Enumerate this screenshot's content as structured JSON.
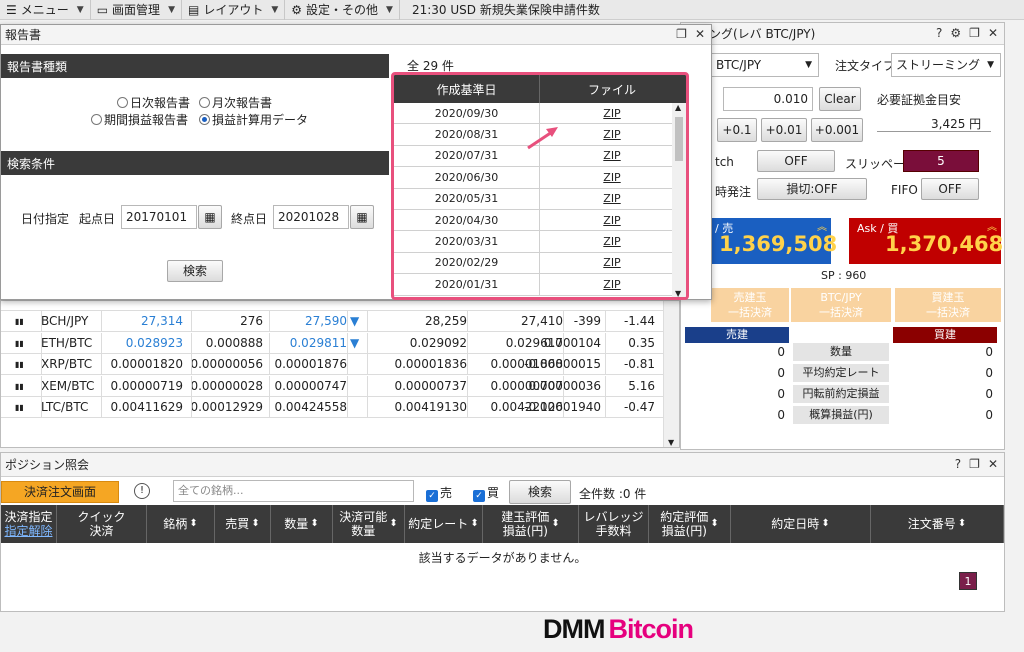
{
  "menubar": {
    "items": [
      {
        "icon": "menu-icon",
        "label": "メニュー"
      },
      {
        "icon": "screen-icon",
        "label": "画面管理"
      },
      {
        "icon": "layout-icon",
        "label": "レイアウト"
      },
      {
        "icon": "gear-icon",
        "label": "設定・その他"
      }
    ],
    "ticker": "21:30  USD  新規失業保険申請件数"
  },
  "trade": {
    "title_fragment": "ーミング(レバ BTC/JPY)",
    "symbol": "BTC/JPY",
    "order_type_label": "注文タイプ",
    "order_type_value": "ストリーミング",
    "qty_value": "0.010",
    "clear_label": "Clear",
    "margin_label": "必要証拠金目安",
    "margin_value": "3,425 円",
    "steps": [
      "+0.1",
      "+0.01",
      "+0.001"
    ],
    "match_label": "tch",
    "match_value": "OFF",
    "slippage_label": "スリッページ",
    "slippage_value": "5",
    "simul_label": "時発注",
    "simul_value": "損切:OFF",
    "fifo_label": "FIFO",
    "fifo_value": "OFF",
    "bid_label": "/ 売",
    "bid_price": "1,369,508",
    "ask_label": "Ask / 買",
    "ask_price": "1,370,468",
    "spread": "SP : 960",
    "bulk_sell": [
      "売建玉",
      "一括決済"
    ],
    "bulk_pair": [
      "BTC/JPY",
      "一括決済"
    ],
    "bulk_buy": [
      "買建玉",
      "一括決済"
    ],
    "sell_head": "売建",
    "buy_head": "買建",
    "summary": [
      {
        "sell": "0",
        "label": "数量",
        "buy": "0"
      },
      {
        "sell": "0",
        "label": "平均約定レート",
        "buy": "0"
      },
      {
        "sell": "0",
        "label": "円転前約定損益",
        "buy": "0"
      },
      {
        "sell": "0",
        "label": "概算損益(円)",
        "buy": "0"
      }
    ]
  },
  "market": {
    "rows": [
      {
        "pair": "BCH/JPY",
        "bid": "27,314",
        "spread": "276",
        "ask": "27,590",
        "low": "28,259",
        "high": "27,410",
        "change": "-399",
        "pct": "-1.44"
      },
      {
        "pair": "ETH/BTC",
        "bid": "0.028923",
        "spread": "0.000888",
        "ask": "0.029811",
        "low": "0.029092",
        "high": "0.029617",
        "change": "0.000104",
        "pct": "0.35"
      },
      {
        "pair": "XRP/BTC",
        "bid": "0.00001820",
        "spread": "0.00000056",
        "ask": "0.00001876",
        "low": "0.00001836",
        "high": "0.00001868",
        "change": "-0.00000015",
        "pct": "-0.81"
      },
      {
        "pair": "XEM/BTC",
        "bid": "0.00000719",
        "spread": "0.00000028",
        "ask": "0.00000747",
        "low": "0.00000737",
        "high": "0.00000707",
        "change": "0.00000036",
        "pct": "5.16"
      },
      {
        "pair": "LTC/BTC",
        "bid": "0.00411629",
        "spread": "0.00012929",
        "ask": "0.00424558",
        "low": "0.00419130",
        "high": "0.00422126",
        "change": "-0.00001940",
        "pct": "-0.47"
      }
    ]
  },
  "report": {
    "title": "報告書",
    "type_section": "報告書種類",
    "radios": [
      "日次報告書",
      "月次報告書",
      "期間損益報告書",
      "損益計算用データ"
    ],
    "cond_section": "検索条件",
    "date_label": "日付指定",
    "start_label": "起点日",
    "start_value": "20170101",
    "end_label": "終点日",
    "end_value": "20201028",
    "search_label": "検索",
    "count": "全 29 件",
    "col_date": "作成基準日",
    "col_file": "ファイル",
    "files": [
      {
        "date": "2020/09/30",
        "file": "ZIP"
      },
      {
        "date": "2020/08/31",
        "file": "ZIP"
      },
      {
        "date": "2020/07/31",
        "file": "ZIP"
      },
      {
        "date": "2020/06/30",
        "file": "ZIP"
      },
      {
        "date": "2020/05/31",
        "file": "ZIP"
      },
      {
        "date": "2020/04/30",
        "file": "ZIP"
      },
      {
        "date": "2020/03/31",
        "file": "ZIP"
      },
      {
        "date": "2020/02/29",
        "file": "ZIP"
      },
      {
        "date": "2020/01/31",
        "file": "ZIP"
      }
    ]
  },
  "position": {
    "title": "ポジション照会",
    "order_btn": "決済注文画面",
    "symbol_placeholder": "全ての銘柄...",
    "sell_chk": "売",
    "buy_chk": "買",
    "search": "検索",
    "total": "全件数 :0 件",
    "headers": [
      {
        "l1": "決済指定",
        "l2": "指定解除"
      },
      {
        "l1": "クイック",
        "l2": "決済"
      },
      {
        "l1": "銘柄",
        "l2": ""
      },
      {
        "l1": "売買",
        "l2": ""
      },
      {
        "l1": "数量",
        "l2": ""
      },
      {
        "l1": "決済可能",
        "l2": "数量"
      },
      {
        "l1": "約定レート",
        "l2": ""
      },
      {
        "l1": "建玉評価",
        "l2": "損益(円)"
      },
      {
        "l1": "レバレッジ",
        "l2": "手数料"
      },
      {
        "l1": "約定評価",
        "l2": "損益(円)"
      },
      {
        "l1": "約定日時",
        "l2": ""
      },
      {
        "l1": "注文番号",
        "l2": ""
      }
    ],
    "empty": "該当するデータがありません。",
    "page": "1"
  },
  "brand": {
    "left": "DMM",
    "right": "Bitcoin"
  },
  "colors": {
    "accent": "#e8507d",
    "bid": "#1a5fc1",
    "ask": "#c00000",
    "brand_pink": "#e6007e"
  }
}
